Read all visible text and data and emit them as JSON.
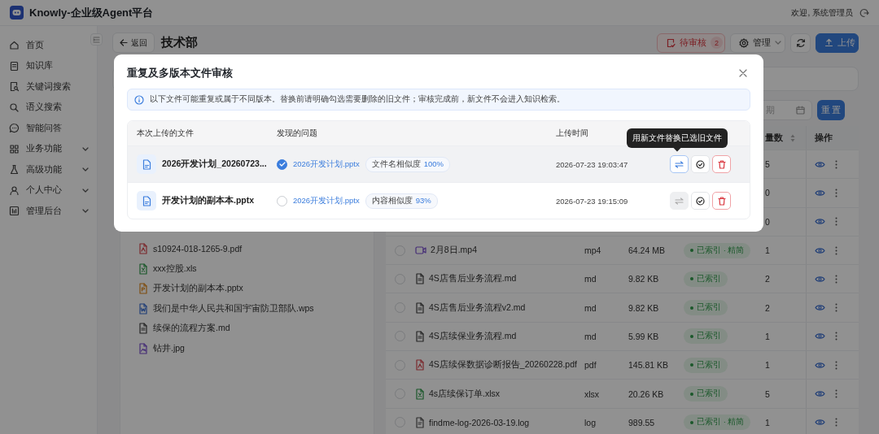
{
  "app": {
    "title": "Knowly-企业级Agent平台",
    "user_greeting": "欢迎, 系统管理员"
  },
  "sidebar": {
    "items": [
      {
        "label": "首页",
        "collapsible": false
      },
      {
        "label": "知识库",
        "collapsible": false
      },
      {
        "label": "关键词搜索",
        "collapsible": false
      },
      {
        "label": "语义搜索",
        "collapsible": false
      },
      {
        "label": "智能问答",
        "collapsible": false
      },
      {
        "label": "业务功能",
        "collapsible": true
      },
      {
        "label": "高级功能",
        "collapsible": true
      },
      {
        "label": "个人中心",
        "collapsible": true
      },
      {
        "label": "管理后台",
        "collapsible": true
      }
    ]
  },
  "page": {
    "back_label": "返回",
    "title": "技术部",
    "pending_button": {
      "label": "待审核",
      "count": "2"
    },
    "manage_button": {
      "label": "管理"
    },
    "upload_button": {
      "label": "上传"
    },
    "date_field": {
      "placeholder": "期"
    },
    "reset_button": {
      "label": "重 置"
    }
  },
  "file_tree": {
    "items": [
      {
        "name": "s10924-018-1265-9.pdf",
        "kind": "pdf"
      },
      {
        "name": "xxx控股.xls",
        "kind": "sheet"
      },
      {
        "name": "开发计划的副本本.pptx",
        "kind": "slides"
      },
      {
        "name": "我们是中华人民共和国宇宙防卫部队.wps",
        "kind": "word"
      },
      {
        "name": "续保的流程方案.md",
        "kind": "text"
      },
      {
        "name": "钻井.jpg",
        "kind": "image"
      }
    ]
  },
  "table": {
    "columns": [
      {
        "kind": "count",
        "label": "量数",
        "sortable": true
      },
      {
        "kind": "actions",
        "label": "操作",
        "sortable": false
      }
    ],
    "rows": [
      {
        "vectors": "5"
      },
      {
        "vectors": "0"
      },
      {
        "vectors": "0"
      },
      {
        "name": "2月8日.mp4",
        "kind": "video",
        "checked": false,
        "type": "mp4",
        "size": "64.24 MB",
        "status": "已索引 · 精简",
        "vectors": "1"
      },
      {
        "name": "4S店售后业务流程.md",
        "kind": "text",
        "checked": false,
        "type": "md",
        "size": "9.82 KB",
        "status": "已索引",
        "vectors": "2"
      },
      {
        "name": "4S店售后业务流程v2.md",
        "kind": "text",
        "checked": false,
        "type": "md",
        "size": "9.82 KB",
        "status": "已索引",
        "vectors": "2"
      },
      {
        "name": "4S店续保业务流程.md",
        "kind": "text",
        "checked": false,
        "type": "md",
        "size": "5.99 KB",
        "status": "已索引",
        "vectors": "1"
      },
      {
        "name": "4S店续保数据诊断报告_20260228.pdf",
        "kind": "pdf",
        "checked": false,
        "type": "pdf",
        "size": "145.81 KB",
        "status": "已索引",
        "vectors": "1"
      },
      {
        "name": "4s店续保订单.xlsx",
        "kind": "sheet",
        "checked": false,
        "type": "xlsx",
        "size": "20.26 KB",
        "status": "已索引",
        "vectors": "5"
      },
      {
        "name": "findme-log-2026-03-19.log",
        "kind": "log",
        "checked": false,
        "type": "log",
        "size": "989.55",
        "status": "已索引 · 精简",
        "vectors": "1"
      }
    ]
  },
  "modal": {
    "title": "重复及多版本文件审核",
    "notice": "以下文件可能重复或属于不同版本。替换前请明确勾选需要删除的旧文件；审核完成前，新文件不会进入知识检索。",
    "columns": [
      "本次上传的文件",
      "发现的问题",
      "上传时间"
    ],
    "rows": [
      {
        "file": "2026开发计划_20260723...",
        "candidate": "2026开发计划.pptx",
        "match_label": "文件名相似度",
        "match_value": "100%",
        "time": "2026-07-23 19:03:47",
        "checked": true,
        "hovered": true
      },
      {
        "file": "开发计划的副本本.pptx",
        "candidate": "2026开发计划.pptx",
        "match_label": "内容相似度",
        "match_value": "93%",
        "time": "2026-07-23 19:15:09",
        "checked": false,
        "hovered": false
      }
    ],
    "tooltip": "用新文件替换已选旧文件"
  }
}
